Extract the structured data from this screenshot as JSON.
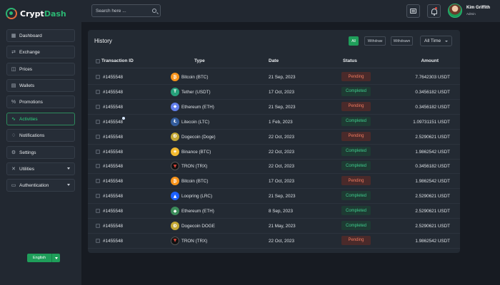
{
  "brand": {
    "prefix": "Crypt",
    "suffix": "Dash"
  },
  "sidebar": {
    "items": [
      {
        "label": "Dashboard",
        "icon": "grid-icon",
        "active": false,
        "expandable": false
      },
      {
        "label": "Exchange",
        "icon": "exchange-icon",
        "active": false,
        "expandable": false
      },
      {
        "label": "Prices",
        "icon": "price-tag-icon",
        "active": false,
        "expandable": false
      },
      {
        "label": "Wallets",
        "icon": "wallet-icon",
        "active": false,
        "expandable": false
      },
      {
        "label": "Promotions",
        "icon": "percent-icon",
        "active": false,
        "expandable": false
      },
      {
        "label": "Activities",
        "icon": "activity-icon",
        "active": true,
        "expandable": false
      },
      {
        "label": "Notifications",
        "icon": "bell-icon",
        "active": false,
        "expandable": false
      },
      {
        "label": "Settings",
        "icon": "gear-icon",
        "active": false,
        "expandable": false
      },
      {
        "label": "Utilities",
        "icon": "tools-icon",
        "active": false,
        "expandable": true
      },
      {
        "label": "Authentication",
        "icon": "briefcase-icon",
        "active": false,
        "expandable": true
      }
    ],
    "language": "English"
  },
  "header": {
    "search_placeholder": "Search here ...",
    "user_name": "Kim Griffith",
    "user_role": "Admin"
  },
  "history": {
    "title": "History",
    "filters": [
      "All",
      "Withdraw",
      "Withdrawn"
    ],
    "active_filter": "All",
    "period": "All Time",
    "columns": [
      "Transaction ID",
      "Type",
      "Date",
      "Status",
      "Amount"
    ],
    "rows": [
      {
        "id": "#1455548",
        "type": "Bitcoin (BTC)",
        "coin": "btc",
        "date": "21 Sep, 2023",
        "status": "Pending",
        "amount": "7.7642303 USDT"
      },
      {
        "id": "#1455548",
        "type": "Tether (USDT)",
        "coin": "usdt",
        "date": "17 Oct, 2023",
        "status": "Completed",
        "amount": "0.3456182 USDT"
      },
      {
        "id": "#1455548",
        "type": "Ethereum (ETH)",
        "coin": "eth",
        "date": "21 Sep, 2023",
        "status": "Pending",
        "amount": "0.3456182 USDT"
      },
      {
        "id": "#1455548",
        "type": "Litecoin (LTC)",
        "coin": "ltc",
        "date": "1 Feb, 2023",
        "status": "Completed",
        "amount": "1.09731151 USDT"
      },
      {
        "id": "#1455548",
        "type": "Dogecoin (Doge)",
        "coin": "doge",
        "date": "22 Oct, 2023",
        "status": "Pending",
        "amount": "2.5290621 USDT"
      },
      {
        "id": "#1455548",
        "type": "Binance (BTC)",
        "coin": "bnb",
        "date": "22 Oct, 2023",
        "status": "Completed",
        "amount": "1.9862542 USDT"
      },
      {
        "id": "#1455548",
        "type": "TRON (TRX)",
        "coin": "trx",
        "date": "22 Oct, 2023",
        "status": "Completed",
        "amount": "0.3456182 USDT"
      },
      {
        "id": "#1455548",
        "type": "Bitcoin (BTC)",
        "coin": "btc",
        "date": "17 Oct, 2023",
        "status": "Pending",
        "amount": "1.9862542 USDT"
      },
      {
        "id": "#1455548",
        "type": "Loopring (LRC)",
        "coin": "lrc",
        "date": "21 Sep, 2023",
        "status": "Completed",
        "amount": "2.5290621 USDT"
      },
      {
        "id": "#1455548",
        "type": "Ethereum (ETH)",
        "coin": "eth2",
        "date": "8 Sep, 2023",
        "status": "Completed",
        "amount": "2.5290621 USDT"
      },
      {
        "id": "#1455548",
        "type": "Dogecoin DOGE",
        "coin": "doge",
        "date": "21 May, 2023",
        "status": "Completed",
        "amount": "2.5290621 USDT"
      },
      {
        "id": "#1455548",
        "type": "TRON (TRX)",
        "coin": "trx",
        "date": "22 Oct, 2023",
        "status": "Pending",
        "amount": "1.9862542 USDT"
      }
    ]
  },
  "colors": {
    "accent": "#1f9e5a",
    "pending": "#f07a5f",
    "completed": "#3fcf8e",
    "coins": {
      "btc": "#f7931a",
      "usdt": "#26a17b",
      "eth": "#627eea",
      "ltc": "#345d9d",
      "doge": "#c2a633",
      "bnb": "#f3ba2f",
      "trx": "#111111",
      "lrc": "#1c60ff",
      "eth2": "#3c8c5a"
    },
    "coin_glyphs": {
      "btc": "₿",
      "usdt": "T",
      "eth": "◆",
      "ltc": "Ł",
      "doge": "Ð",
      "bnb": "◈",
      "trx": "▼",
      "lrc": "▲",
      "eth2": "◆"
    }
  }
}
